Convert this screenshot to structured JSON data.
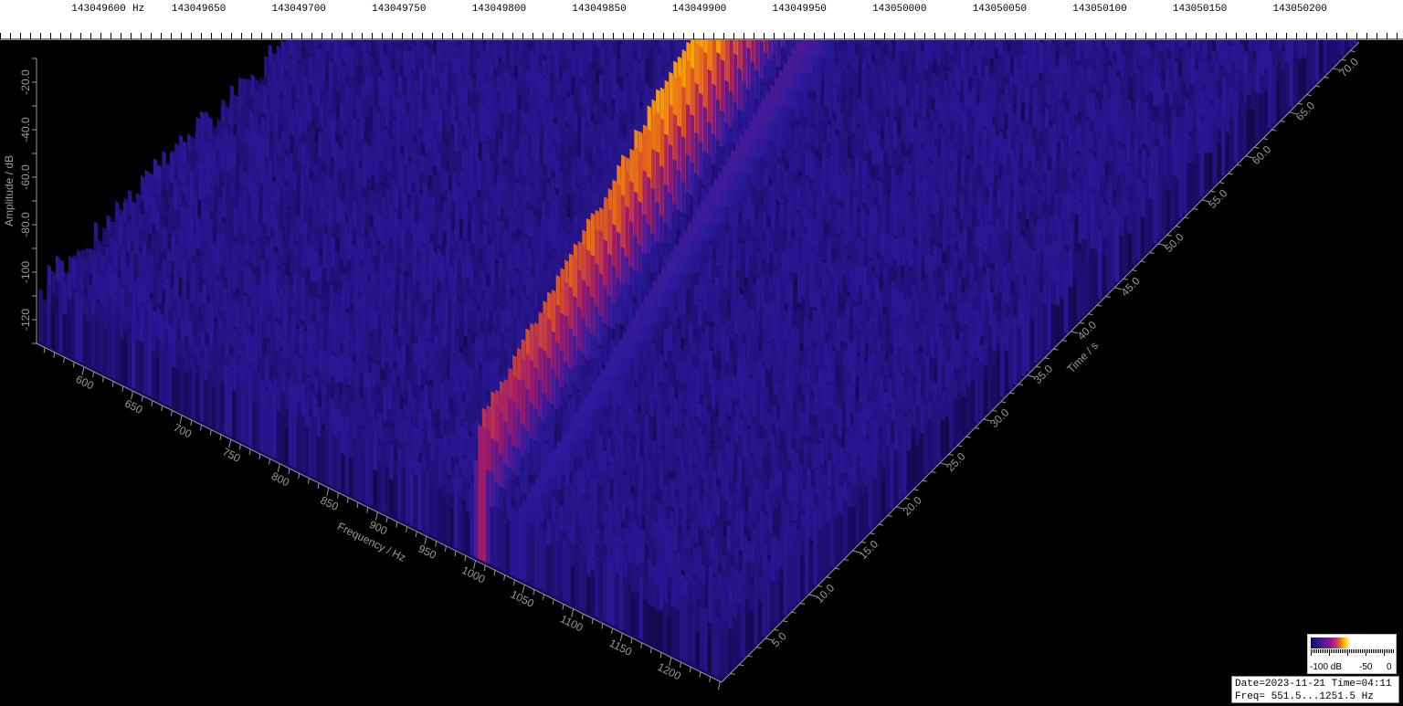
{
  "chart_data": {
    "type": "waterfall-3d",
    "top_axis": {
      "unit": "Hz",
      "tick_labels": [
        "143049600",
        "143049650",
        "143049700",
        "143049750",
        "143049800",
        "143049850",
        "143049900",
        "143049950",
        "143050000",
        "143050050",
        "143050100",
        "143050150",
        "143050200"
      ]
    },
    "amplitude_axis": {
      "title": "Amplitude / dB",
      "tick_labels": [
        "-20.0",
        "-40.0",
        "-60.0",
        "-80.0",
        "-100",
        "-120"
      ],
      "range": [
        -130,
        -10
      ]
    },
    "frequency_axis": {
      "title": "Frequency / Hz",
      "tick_labels": [
        "600",
        "650",
        "700",
        "750",
        "800",
        "850",
        "900",
        "950",
        "1000",
        "1050",
        "1100",
        "1150",
        "1200"
      ],
      "range": [
        551.5,
        1251.5
      ]
    },
    "time_axis": {
      "title": "Time / s",
      "tick_labels": [
        "5.0",
        "10.0",
        "15.0",
        "20.0",
        "25.0",
        "30.0",
        "35.0",
        "40.0",
        "45.0",
        "50.0",
        "55.0",
        "60.0",
        "65.0",
        "70.0"
      ],
      "range": [
        0,
        73
      ]
    },
    "signal": {
      "description": "drifting carrier",
      "freq_start_hz": 1005,
      "freq_end_hz": 820,
      "peak_db": -40,
      "noise_floor_db": -115
    },
    "colormap": [
      "#000000",
      "#1a0a5e",
      "#2c1a9e",
      "#5a1a8e",
      "#a01a6a",
      "#e05a20",
      "#ffb000",
      "#ffe040"
    ]
  },
  "legend": {
    "labels": [
      "-100 dB",
      "-50",
      "0"
    ]
  },
  "info": {
    "line1": "Date=2023-11-21 Time=04:11",
    "line2": "Freq= 551.5...1251.5 Hz"
  }
}
